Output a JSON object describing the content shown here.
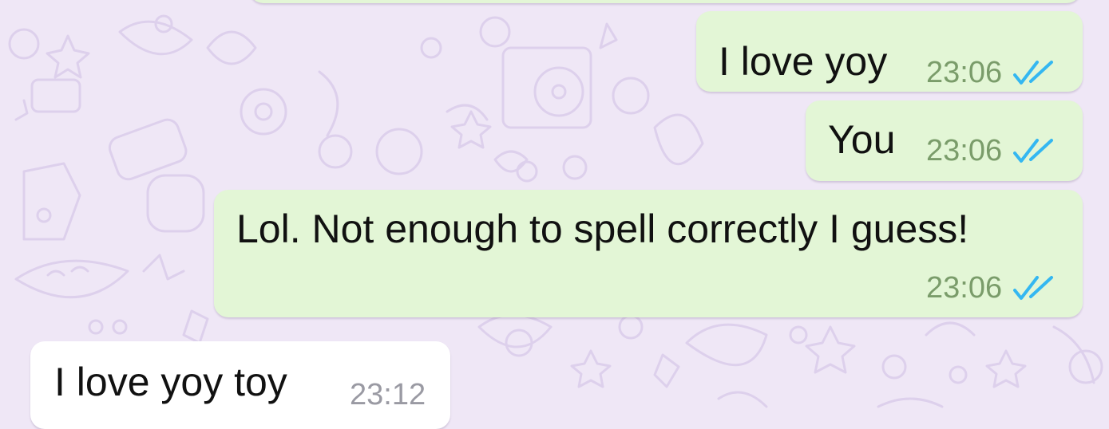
{
  "colors": {
    "wallpaper": "#efe7f6",
    "outgoing_bubble": "#e3f6d6",
    "incoming_bubble": "#ffffff",
    "read_tick": "#34b7f1"
  },
  "messages": [
    {
      "text": "I love yoy",
      "time": "23:06",
      "direction": "outgoing",
      "status_icon": "double-check-read-icon"
    },
    {
      "text": "You",
      "time": "23:06",
      "direction": "outgoing",
      "status_icon": "double-check-read-icon"
    },
    {
      "text": "Lol. Not enough to spell correctly I guess!",
      "time": "23:06",
      "direction": "outgoing",
      "status_icon": "double-check-read-icon"
    },
    {
      "text": "I love yoy toy",
      "time": "23:12",
      "direction": "incoming"
    }
  ]
}
